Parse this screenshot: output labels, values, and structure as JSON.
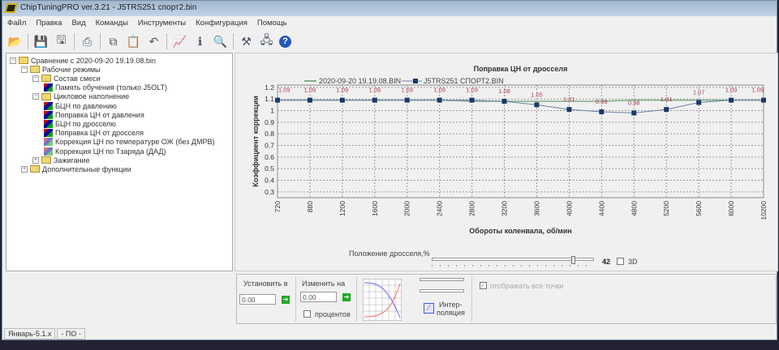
{
  "window": {
    "title": "ChipTuningPRO ver.3.21 - J5TRS251 спорт2.bin"
  },
  "menu": [
    "Файл",
    "Правка",
    "Вид",
    "Команды",
    "Инструменты",
    "Конфигурация",
    "Помощь"
  ],
  "toolbar": {
    "icons": [
      "open-icon",
      "save-icon",
      "save-as-icon",
      "print-icon",
      "copy-icon",
      "paste-icon",
      "undo-icon",
      "chart-icon",
      "info-icon",
      "search-icon",
      "tools-icon",
      "network-icon",
      "help-icon"
    ]
  },
  "tree": [
    {
      "label": "Сравнение с 2020-09-20 19.19.08.bin",
      "level": 0,
      "type": "folder",
      "pm": "−"
    },
    {
      "label": "Рабочие режимы",
      "level": 1,
      "type": "folder",
      "pm": "−"
    },
    {
      "label": "Состав смеси",
      "level": 2,
      "type": "folder",
      "pm": "−"
    },
    {
      "label": "Память обучения (только J5OLT)",
      "level": 3,
      "type": "map"
    },
    {
      "label": "Цикловое наполнение",
      "level": 2,
      "type": "folder",
      "pm": "−"
    },
    {
      "label": "БЦН по давлению",
      "level": 3,
      "type": "map"
    },
    {
      "label": "Поправка ЦН от давления",
      "level": 3,
      "type": "map"
    },
    {
      "label": "БЦН по дросселю",
      "level": 3,
      "type": "map"
    },
    {
      "label": "Поправка ЦН от дросселя",
      "level": 3,
      "type": "map"
    },
    {
      "label": "Коррекция ЦН по температуре ОЖ (без ДМРВ)",
      "level": 3,
      "type": "map-gray"
    },
    {
      "label": "Коррекция ЦН по Тзаряда (ДАД)",
      "level": 3,
      "type": "map-gray"
    },
    {
      "label": "Зажигание",
      "level": 2,
      "type": "folder",
      "pm": "+"
    },
    {
      "label": "Дополнительные функции",
      "level": 1,
      "type": "folder",
      "pm": "+"
    }
  ],
  "chart_data": {
    "type": "line",
    "title": "Поправка ЦН от дросселя",
    "xlabel": "Обороты коленвала, об/мин",
    "ylabel": "Коэффициент коррекции",
    "categories": [
      "720",
      "880",
      "1200",
      "1600",
      "2000",
      "2400",
      "2800",
      "3200",
      "3600",
      "4000",
      "4400",
      "4800",
      "5200",
      "5600",
      "6000",
      "10200"
    ],
    "ylim": [
      0.25,
      1.22
    ],
    "yticks": [
      "1.2",
      "1.1",
      "1",
      "0.9",
      "0.8",
      "0.7",
      "0.6",
      "0.5",
      "0.4",
      "0.3"
    ],
    "grid": true,
    "legend": "top",
    "series": [
      {
        "name": "2020-09-20 19.19.08.BIN",
        "color": "#7fae8a",
        "values": [
          1.09,
          1.09,
          1.09,
          1.09,
          1.09,
          1.09,
          1.08,
          1.08,
          1.08,
          1.08,
          1.08,
          1.09,
          1.09,
          1.09,
          1.09,
          1.09
        ]
      },
      {
        "name": "J5TRS251 СПОРТ2.BIN",
        "color": "#7080a8",
        "marker": "#1a3a6a",
        "values": [
          1.09,
          1.09,
          1.09,
          1.09,
          1.09,
          1.09,
          1.09,
          1.08,
          1.05,
          1.01,
          0.99,
          0.98,
          1.01,
          1.07,
          1.09,
          1.09
        ],
        "labels": [
          "1.09",
          "1.09",
          "1.09",
          "1.09",
          "1.09",
          "1.09",
          "1.09",
          "1.08",
          "1.05",
          "1.01",
          "0.99",
          "0.98",
          "1.01",
          "1.07",
          "1.09",
          "1.09"
        ]
      }
    ]
  },
  "throttle": {
    "label": "Положение дросселя,%",
    "value": "42",
    "percent": 42,
    "checkbox_3d": "3D"
  },
  "bottom": {
    "set_label": "Установить в",
    "set_value": "0.00",
    "change_label": "Изменить на",
    "change_value": "0.00",
    "percent_label": "процентов",
    "interp_label1": "Интер-",
    "interp_label2": "поляция",
    "show_all": "отображать все точки"
  },
  "status": [
    "Январь-5.1.x",
    "- ПО -"
  ]
}
